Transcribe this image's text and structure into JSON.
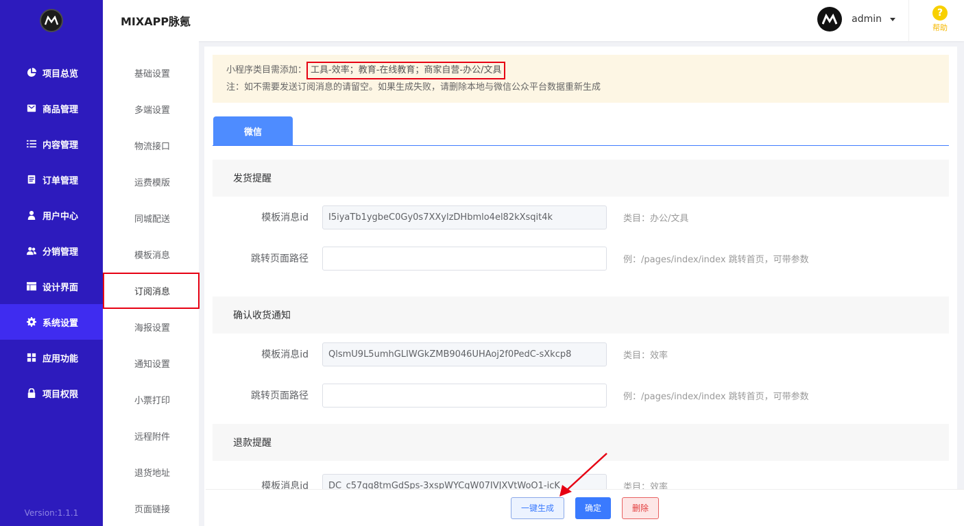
{
  "app": {
    "title": "MIXAPP脉氪",
    "version": "Version:1.1.1"
  },
  "header": {
    "username": "admin",
    "help_label": "帮助",
    "help_glyph": "?"
  },
  "sidebar": {
    "items": [
      {
        "label": "项目总览",
        "icon": "pie-chart-icon"
      },
      {
        "label": "商品管理",
        "icon": "mail-icon"
      },
      {
        "label": "内容管理",
        "icon": "list-icon"
      },
      {
        "label": "订单管理",
        "icon": "document-icon"
      },
      {
        "label": "用户中心",
        "icon": "user-icon"
      },
      {
        "label": "分销管理",
        "icon": "users-icon"
      },
      {
        "label": "设计界面",
        "icon": "layout-icon"
      },
      {
        "label": "系统设置",
        "icon": "gear-icon",
        "active": true
      },
      {
        "label": "应用功能",
        "icon": "grid-icon"
      },
      {
        "label": "项目权限",
        "icon": "lock-icon"
      }
    ]
  },
  "submenu": {
    "items": [
      "基础设置",
      "多端设置",
      "物流接口",
      "运费模版",
      "同城配送",
      "模板消息",
      "订阅消息",
      "海报设置",
      "通知设置",
      "小票打印",
      "远程附件",
      "退货地址",
      "页面链接"
    ],
    "active": "订阅消息"
  },
  "notice": {
    "prefix": "小程序类目需添加：",
    "categories": "工具-效率；教育-在线教育；商家自营-办公/文具",
    "note": "注：如不需要发送订阅消息的请留空。如果生成失败，请删除本地与微信公众平台数据重新生成"
  },
  "tabs": {
    "wechat": "微信"
  },
  "form": {
    "template_label": "模板消息id",
    "path_label": "跳转页面路径",
    "path_hint": "例：/pages/index/index 跳转首页，可带参数",
    "sections": [
      {
        "title": "发货提醒",
        "template_id": "I5iyaTb1ygbeC0Gy0s7XXylzDHbmlo4el82kXsqit4k",
        "category": "类目：办公/文具"
      },
      {
        "title": "确认收货通知",
        "template_id": "QlsmU9L5umhGLIWGkZMB9046UHAoj2f0PedC-sXkcp8",
        "category": "类目：效率"
      },
      {
        "title": "退款提醒",
        "template_id": "DC_c57gg8tmGdSps-3xspWYCgW07IVJXVtWoO1-icK",
        "category": "类目：效率"
      }
    ]
  },
  "footer": {
    "generate": "一键生成",
    "confirm": "确定",
    "delete": "删除"
  }
}
